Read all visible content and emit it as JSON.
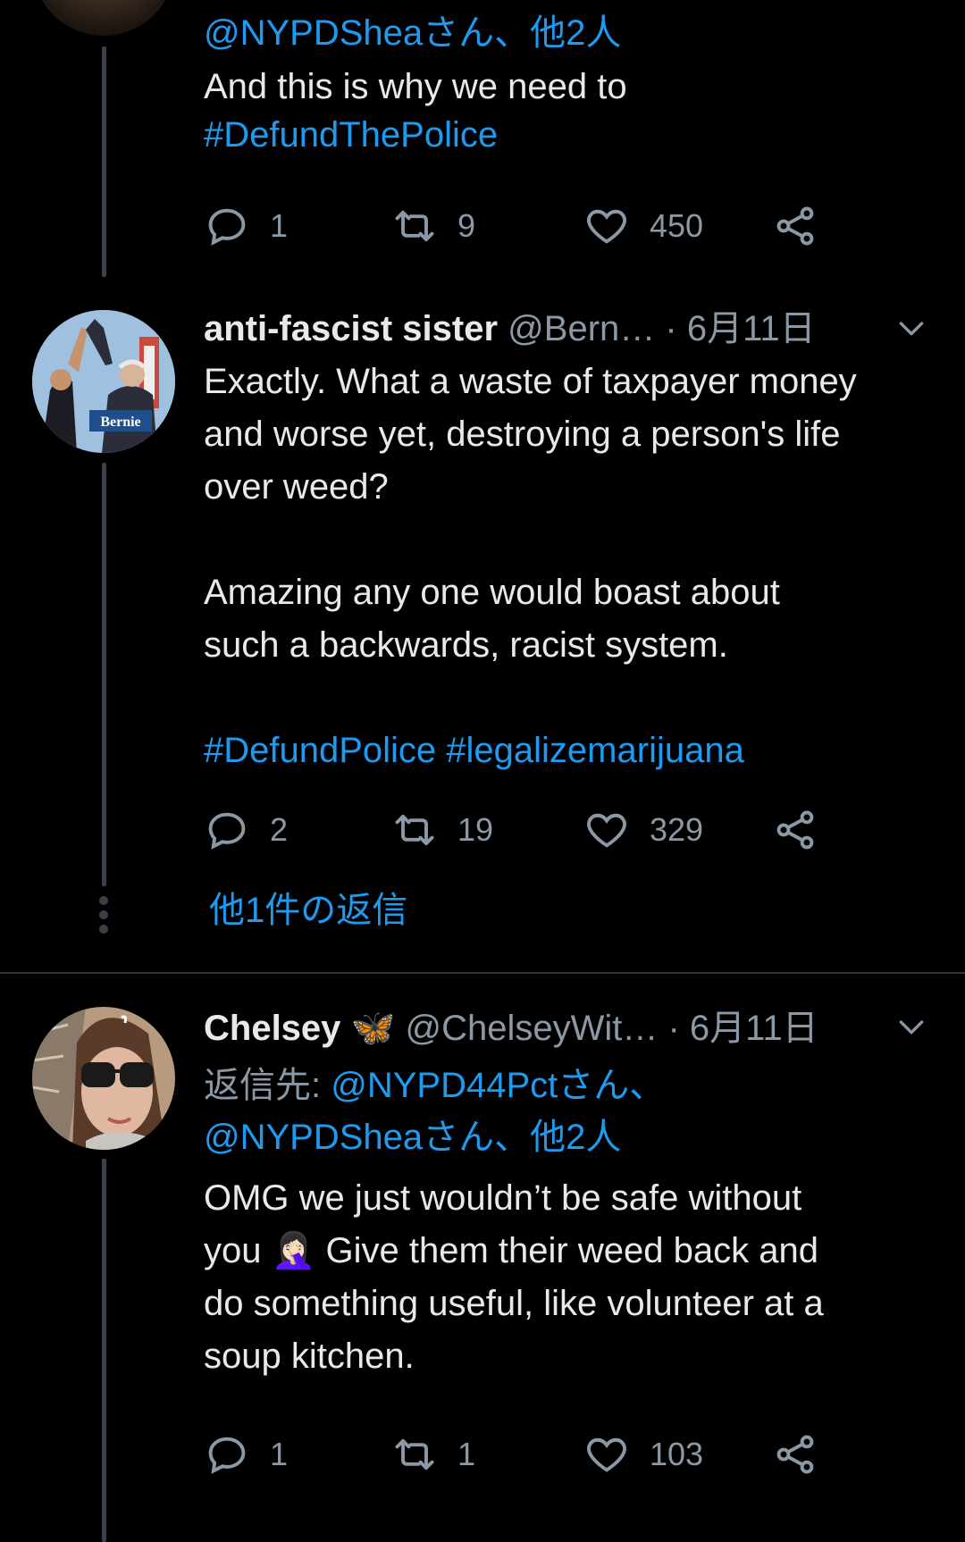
{
  "tweet1": {
    "reply_to_users": "@NYPDSheaさん、他2人",
    "text_line1": "And this is why we need to",
    "hashtag": "#DefundThePolice",
    "stats": {
      "replies": "1",
      "retweets": "9",
      "likes": "450"
    }
  },
  "tweet2": {
    "name": "anti-fascist sister",
    "handle": "@Bern…",
    "date": "· 6月11日",
    "avatar_sign_text": "Bernie",
    "lines": [
      "Exactly. What a waste of taxpayer money",
      "and worse yet, destroying a person's life",
      "over weed?",
      "",
      "Amazing any one would boast about",
      "such a backwards, racist system.",
      ""
    ],
    "hashtags": "#DefundPolice #legalizemarijuana",
    "stats": {
      "replies": "2",
      "retweets": "19",
      "likes": "329"
    },
    "more_replies": "他1件の返信"
  },
  "tweet3": {
    "name": "Chelsey",
    "emoji": "🦋",
    "handle": "@ChelseyWit…",
    "date": "· 6月11日",
    "reply_label": "返信先: ",
    "reply_to_1": "@NYPD44Pctさん、",
    "reply_to_2": "@NYPDSheaさん、他2人",
    "line1": "OMG we just wouldn’t be safe without",
    "line2a": "you ",
    "facepalm": "🤦🏻‍♀️",
    "line2b": " Give them their weed back and",
    "line3": "do something useful, like volunteer at a",
    "line4": "soup kitchen.",
    "stats": {
      "replies": "1",
      "retweets": "1",
      "likes": "103"
    }
  },
  "colors": {
    "accent": "#1d9bf0",
    "muted": "#8b98a5",
    "background": "#000000",
    "text": "#e7e9ea"
  }
}
